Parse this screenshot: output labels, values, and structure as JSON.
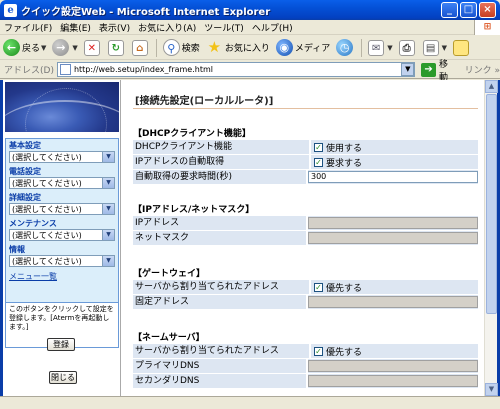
{
  "window": {
    "title": "クイック設定Web - Microsoft Internet Explorer",
    "min": "_",
    "max": "□",
    "close": "×"
  },
  "menu": [
    "ファイル(F)",
    "編集(E)",
    "表示(V)",
    "お気に入り(A)",
    "ツール(T)",
    "ヘルプ(H)"
  ],
  "toolbar": {
    "back": "戻る",
    "search": "検索",
    "favorites": "お気に入り",
    "media": "メディア"
  },
  "address": {
    "label": "アドレス(D)",
    "url": "http://web.setup/index_frame.html",
    "go": "移動",
    "links": "リンク »"
  },
  "left": {
    "groups": [
      {
        "label": "基本設定",
        "value": "(選択してください)"
      },
      {
        "label": "電話設定",
        "value": "(選択してください)"
      },
      {
        "label": "詳細設定",
        "value": "(選択してください)"
      },
      {
        "label": "メンテナンス",
        "value": "(選択してください)"
      },
      {
        "label": "情報",
        "value": "(選択してください)"
      }
    ],
    "menu_link": "メニュー一覧",
    "note": "このボタンをクリックして設定を登録します。[Atermを再起動します。]",
    "save": "登録",
    "close": "閉じる"
  },
  "main": {
    "title": "[接続先設定(ローカルルータ)]",
    "sections": [
      {
        "heading": "【DHCPクライアント機能】",
        "rows": [
          {
            "label": "DHCPクライアント機能",
            "type": "checkbox",
            "checked": true,
            "text": "使用する"
          },
          {
            "label": "IPアドレスの自動取得",
            "type": "checkbox",
            "checked": true,
            "text": "要求する"
          },
          {
            "label": "自動取得の要求時間(秒)",
            "type": "text",
            "value": "300"
          }
        ]
      },
      {
        "heading": "【IPアドレス/ネットマスク】",
        "rows": [
          {
            "label": "IPアドレス",
            "type": "text-disabled",
            "value": ""
          },
          {
            "label": "ネットマスク",
            "type": "text-disabled",
            "value": ""
          }
        ]
      },
      {
        "heading": "【ゲートウェイ】",
        "rows": [
          {
            "label": "サーバから割り当てられたアドレス",
            "type": "checkbox",
            "checked": true,
            "text": "優先する"
          },
          {
            "label": "固定アドレス",
            "type": "text-disabled",
            "value": ""
          }
        ]
      },
      {
        "heading": "【ネームサーバ】",
        "rows": [
          {
            "label": "サーバから割り当てられたアドレス",
            "type": "checkbox",
            "checked": true,
            "text": "優先する"
          },
          {
            "label": "プライマリDNS",
            "type": "text-disabled",
            "value": ""
          },
          {
            "label": "セカンダリDNS",
            "type": "text-disabled",
            "value": ""
          }
        ]
      }
    ]
  }
}
